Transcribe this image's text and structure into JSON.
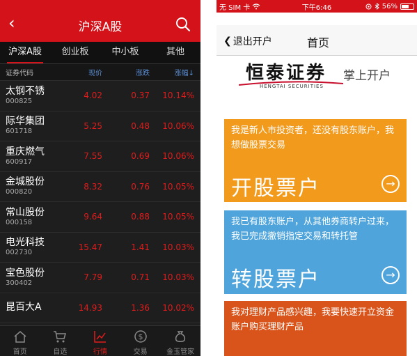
{
  "left": {
    "nav": {
      "title": "沪深A股"
    },
    "tabs": [
      "沪深A股",
      "创业板",
      "中小板",
      "其他"
    ],
    "columns": {
      "code": "证券代码",
      "price": "现价",
      "change": "涨跌",
      "pct": "涨幅↓"
    },
    "stocks": [
      {
        "name": "太钢不锈",
        "code": "000825",
        "price": "4.02",
        "change": "0.37",
        "pct": "10.14%"
      },
      {
        "name": "际华集团",
        "code": "601718",
        "price": "5.25",
        "change": "0.48",
        "pct": "10.06%"
      },
      {
        "name": "重庆燃气",
        "code": "600917",
        "price": "7.55",
        "change": "0.69",
        "pct": "10.06%"
      },
      {
        "name": "金城股份",
        "code": "000820",
        "price": "8.32",
        "change": "0.76",
        "pct": "10.05%"
      },
      {
        "name": "常山股份",
        "code": "000158",
        "price": "9.64",
        "change": "0.88",
        "pct": "10.05%"
      },
      {
        "name": "电光科技",
        "code": "002730",
        "price": "15.47",
        "change": "1.41",
        "pct": "10.03%"
      },
      {
        "name": "宝色股份",
        "code": "300402",
        "price": "7.79",
        "change": "0.71",
        "pct": "10.03%"
      },
      {
        "name": "昆百大A",
        "code": "",
        "price": "14.93",
        "change": "1.36",
        "pct": "10.02%"
      }
    ],
    "tabbar": [
      {
        "label": "首页",
        "icon": "home-icon"
      },
      {
        "label": "自选",
        "icon": "cart-icon"
      },
      {
        "label": "行情",
        "icon": "trend-icon"
      },
      {
        "label": "交易",
        "icon": "dollar-icon"
      },
      {
        "label": "金玉管家",
        "icon": "moneybag-icon"
      }
    ],
    "accent": "#d4121a",
    "price_color": "#e11c1c"
  },
  "right": {
    "status": {
      "carrier": "无 SIM 卡",
      "time": "下午6:46",
      "battery": "56%"
    },
    "nav": {
      "back_label": "退出开户",
      "title": "首页"
    },
    "logo": {
      "name": "恒泰证券",
      "sub": "HENGTAI SECURITIES",
      "tagline": "掌上开户"
    },
    "cards": [
      {
        "desc": "我是新人市投资者，还没有股东账户，我想做股票交易",
        "title": "开股票户",
        "color": "#f19a1c"
      },
      {
        "desc": "我已有股东账户，从其他券商转户过来，我已完成撤销指定交易和转托管",
        "title": "转股票户",
        "color": "#4fa4db"
      },
      {
        "desc": "我对理财产品感兴趣，我要快速开立资金账户购买理财产品",
        "title": "",
        "color": "#d9541a"
      }
    ]
  }
}
